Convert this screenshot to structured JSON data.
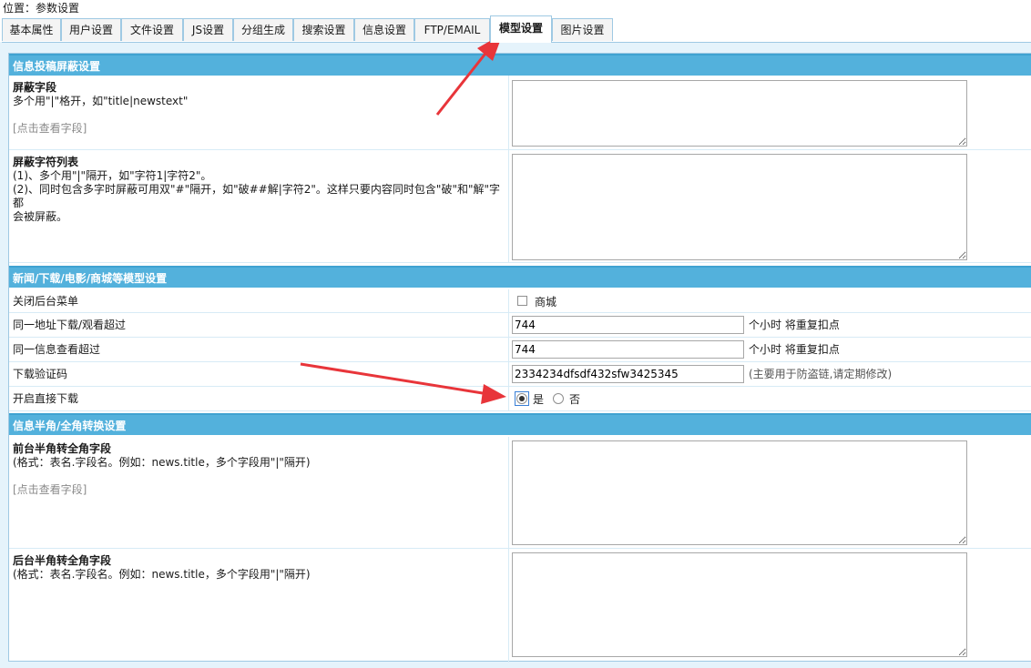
{
  "breadcrumb": {
    "label": "位置：参数设置"
  },
  "tabs": [
    {
      "label": "基本属性"
    },
    {
      "label": "用户设置"
    },
    {
      "label": "文件设置"
    },
    {
      "label": "JS设置"
    },
    {
      "label": "分组生成"
    },
    {
      "label": "搜索设置"
    },
    {
      "label": "信息设置"
    },
    {
      "label": "FTP/EMAIL"
    },
    {
      "label": "模型设置",
      "active": true
    },
    {
      "label": "图片设置"
    }
  ],
  "sections": {
    "shield": {
      "title": "信息投稿屏蔽设置",
      "fields": {
        "title": "屏蔽字段",
        "desc": "多个用\"|\"格开，如\"title|newstext\"",
        "link": "[点击查看字段]",
        "value": ""
      },
      "chars": {
        "title": "屏蔽字符列表",
        "line1": "(1)、多个用\"|\"隔开，如\"字符1|字符2\"。",
        "line2": "(2)、同时包含多字时屏蔽可用双\"#\"隔开，如\"破##解|字符2\"。这样只要内容同时包含\"破\"和\"解\"字都",
        "line3": "会被屏蔽。",
        "value": ""
      }
    },
    "model": {
      "title": "新闻/下载/电影/商城等模型设置",
      "close_menu": {
        "label": "关闭后台菜单",
        "option": "商城",
        "checked": false
      },
      "download_exceed": {
        "label": "同一地址下载/观看超过",
        "value": "744",
        "suffix": "个小时 将重复扣点"
      },
      "view_exceed": {
        "label": "同一信息查看超过",
        "value": "744",
        "suffix": "个小时 将重复扣点"
      },
      "captcha": {
        "label": "下载验证码",
        "value": "2334234dfsdf432sfw3425345",
        "suffix": "(主要用于防盗链,请定期修改)"
      },
      "direct_download": {
        "label": "开启直接下载",
        "yes": "是",
        "no": "否",
        "selected": "是"
      }
    },
    "width": {
      "title": "信息半角/全角转换设置",
      "front": {
        "title": "前台半角转全角字段",
        "desc": "(格式：表名.字段名。例如：news.title，多个字段用\"|\"隔开)",
        "link": "[点击查看字段]",
        "value": ""
      },
      "back": {
        "title": "后台半角转全角字段",
        "desc": "(格式：表名.字段名。例如：news.title，多个字段用\"|\"隔开)",
        "value": ""
      }
    }
  },
  "colors": {
    "header": "#53b1dc",
    "tab_border": "#9fc9e3",
    "arrow": "#e8353a"
  }
}
